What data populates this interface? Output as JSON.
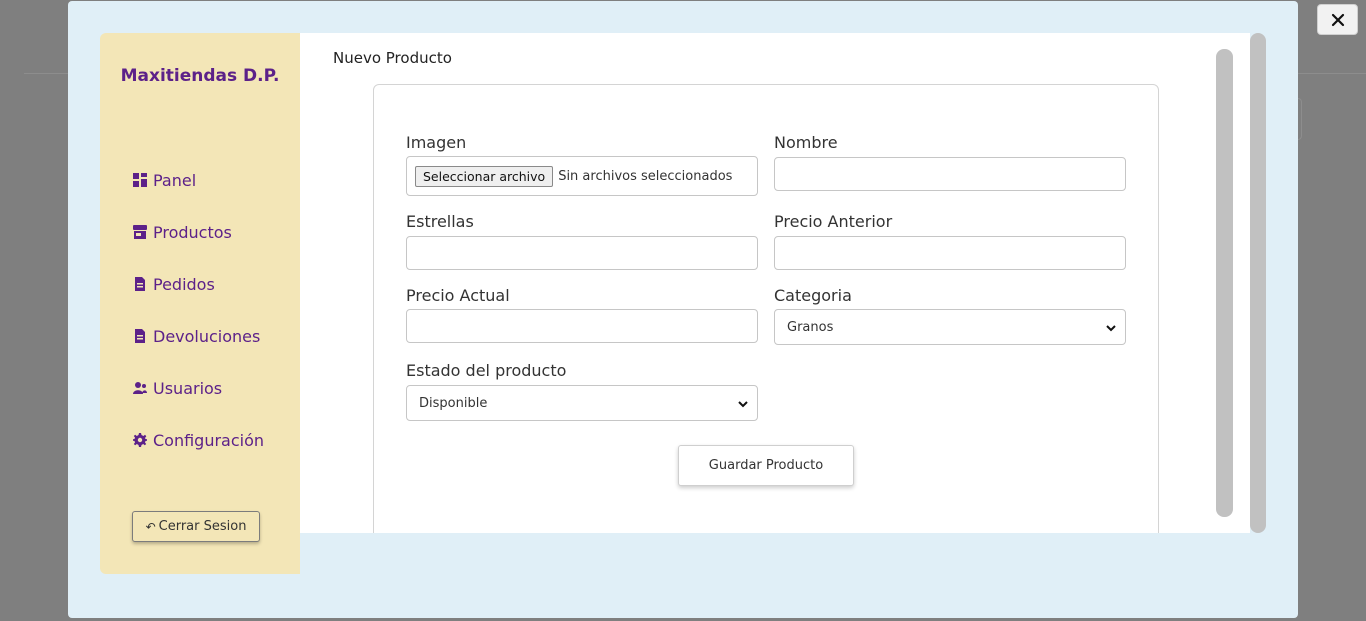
{
  "sidebar": {
    "brand": "Maxitiendas D.P.",
    "items": [
      {
        "label": "Panel",
        "icon": "grid-icon"
      },
      {
        "label": "Productos",
        "icon": "store-icon"
      },
      {
        "label": "Pedidos",
        "icon": "document-icon"
      },
      {
        "label": "Devoluciones",
        "icon": "document-icon"
      },
      {
        "label": "Usuarios",
        "icon": "users-icon"
      },
      {
        "label": "Configuración",
        "icon": "gear-icon"
      }
    ],
    "logout_label": "Cerrar Sesion",
    "logout_icon": "logout-icon"
  },
  "form": {
    "title": "Nuevo Producto",
    "image_label": "Imagen",
    "file_button": "Seleccionar archivo",
    "file_status": "Sin archivos seleccionados",
    "name_label": "Nombre",
    "name_value": "",
    "stars_label": "Estrellas",
    "stars_value": "",
    "old_price_label": "Precio Anterior",
    "old_price_value": "",
    "current_price_label": "Precio Actual",
    "current_price_value": "",
    "category_label": "Categoria",
    "category_value": "Granos",
    "status_label": "Estado del producto",
    "status_value": "Disponible",
    "save_label": "Guardar Producto"
  },
  "colors": {
    "accent": "#5c2189",
    "sidebar_bg": "#f3e6b7",
    "modal_bg": "#e0eff7",
    "overlay": "#7f7f7f"
  }
}
